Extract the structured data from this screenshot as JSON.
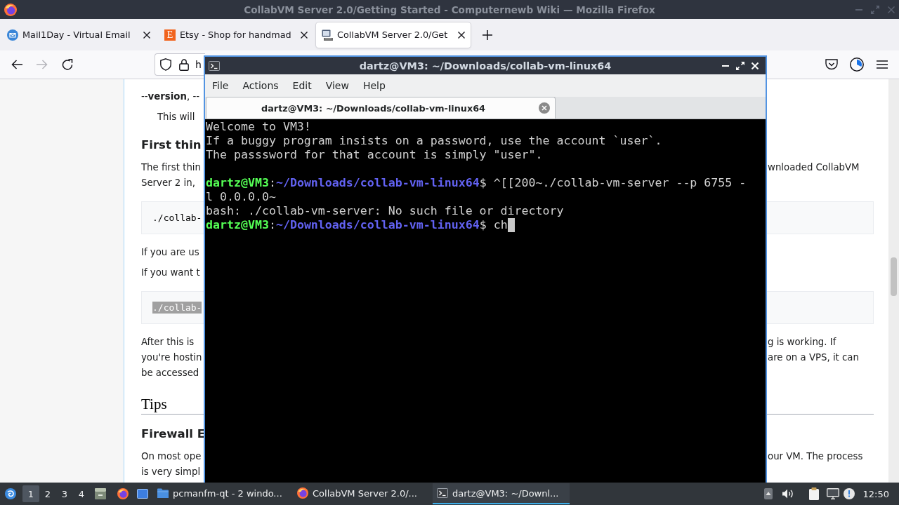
{
  "browser": {
    "title": "CollabVM Server 2.0/Getting Started - Computernewb Wiki — Mozilla Firefox",
    "tabs": [
      {
        "label": "Mail1Day - Virtual Email",
        "selected": false
      },
      {
        "label": "Etsy - Shop for handmad",
        "favicon_text": "E",
        "selected": false
      },
      {
        "label": "CollabVM Server 2.0/Get",
        "selected": true
      }
    ],
    "nav_buttons": [
      {
        "kind": "back",
        "disabled": false
      },
      {
        "kind": "forward",
        "disabled": true
      },
      {
        "kind": "reload",
        "disabled": false
      }
    ],
    "url": {
      "value": "h"
    }
  },
  "article": {
    "blocks": [
      {
        "kind": "text",
        "lines": [
          {
            "left": "--**version**, --"
          }
        ]
      },
      {
        "kind": "indent",
        "lines": [
          {
            "left": "This will"
          }
        ]
      },
      {
        "kind": "heading",
        "text": "First thin"
      },
      {
        "kind": "text",
        "lines": [
          {
            "left": "The first thin",
            "right": "wnloaded CollabVM"
          },
          {
            "left": "Server 2 in,"
          }
        ]
      },
      {
        "kind": "code",
        "text": "./collab-",
        "highlighted": false
      },
      {
        "kind": "text",
        "lines": [
          {
            "left": "If you are us"
          }
        ]
      },
      {
        "kind": "text",
        "lines": [
          {
            "left": "If you want t"
          }
        ]
      },
      {
        "kind": "code",
        "text": "./collab-",
        "highlighted": true
      },
      {
        "kind": "text",
        "lines": [
          {
            "left": "After this is",
            "right": "g is working. If"
          },
          {
            "left": "you're hostin",
            "right": "are on a VPS, it can"
          },
          {
            "left": "be accessed"
          }
        ]
      },
      {
        "kind": "section",
        "text": "Tips"
      },
      {
        "kind": "heading",
        "text": "Firewall E"
      },
      {
        "kind": "text",
        "lines": [
          {
            "left": "On most ope",
            "right": "our VM. The process"
          },
          {
            "left": "is very simpl"
          }
        ]
      }
    ]
  },
  "terminal": {
    "title": "dartz@VM3: ~/Downloads/collab-vm-linux64",
    "menu": [
      "File",
      "Actions",
      "Edit",
      "View",
      "Help"
    ],
    "tabs": [
      {
        "label": "dartz@VM3: ~/Downloads/collab-vm-linux64",
        "selected": true
      }
    ],
    "lines": [
      {
        "kind": "output",
        "text": "Welcome to VM3!"
      },
      {
        "kind": "output",
        "text": "If a buggy program insists on a password, use the account `user`."
      },
      {
        "kind": "output",
        "text": "The passsword for that account is simply \"user\"."
      },
      {
        "kind": "blank"
      },
      {
        "kind": "prompt",
        "user": "dartz@VM3",
        "separator": ":",
        "path": "~/Downloads/collab-vm-linux64",
        "symbol": "$",
        "command": "^[[200~./collab-vm-server --p 6755 -l 0.0.0.0~",
        "cursor": false
      },
      {
        "kind": "output",
        "text": "bash: ./collab-vm-server: No such file or directory"
      },
      {
        "kind": "prompt",
        "user": "dartz@VM3",
        "separator": ":",
        "path": "~/Downloads/collab-vm-linux64",
        "symbol": "$",
        "command": "ch",
        "cursor": true
      }
    ]
  },
  "taskbar": {
    "desktops": [
      {
        "label": "1",
        "selected": true
      },
      {
        "label": "2",
        "selected": false
      },
      {
        "label": "3",
        "selected": false
      },
      {
        "label": "4",
        "selected": false
      }
    ],
    "tasks": [
      {
        "label": "pcmanfm-qt - 2 windo...",
        "active": false
      },
      {
        "label": "CollabVM Server 2.0/...",
        "active": false
      },
      {
        "label": "dartz@VM3: ~/Downl...",
        "active": true
      }
    ],
    "clock": "12:50"
  }
}
